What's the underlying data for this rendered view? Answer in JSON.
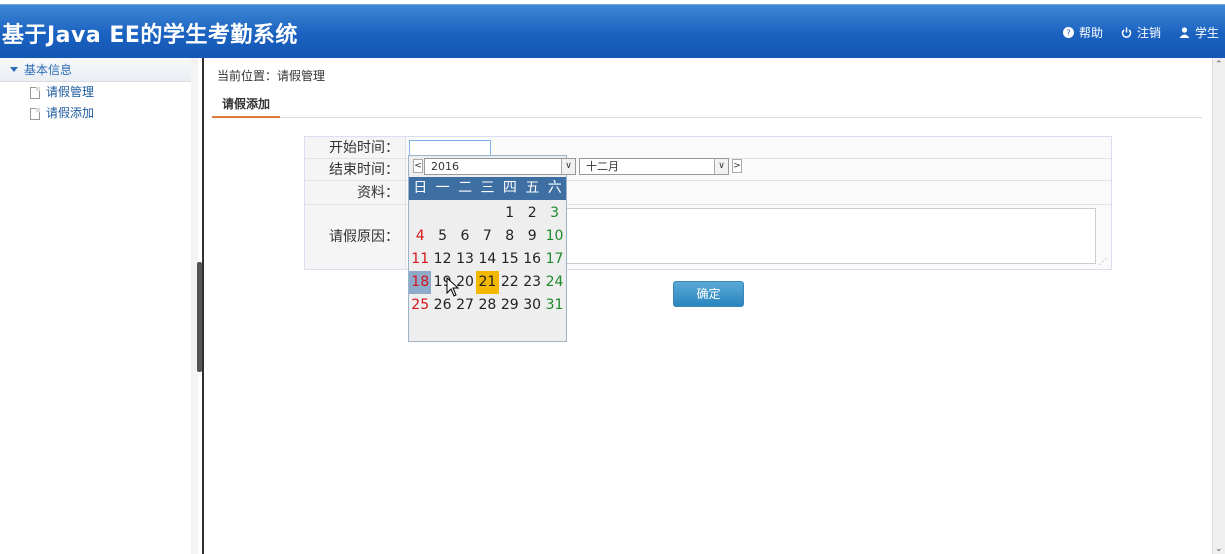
{
  "header": {
    "title": "基于Java EE的学生考勤系统",
    "nav": [
      {
        "icon": "help-icon",
        "label": "帮助"
      },
      {
        "icon": "power-icon",
        "label": "注销"
      },
      {
        "icon": "user-icon",
        "label": "学生"
      }
    ]
  },
  "sidebar": {
    "group_label": "基本信息",
    "items": [
      {
        "label": "请假管理"
      },
      {
        "label": "请假添加"
      }
    ]
  },
  "main": {
    "breadcrumb": "当前位置：请假管理",
    "tab_label": "请假添加",
    "form": {
      "start_label": "开始时间：",
      "end_label": "结束时间：",
      "material_label": "资料：",
      "reason_label": "请假原因："
    },
    "submit_label": "确定"
  },
  "datepicker": {
    "prev": "<",
    "next": ">",
    "year": "2016",
    "month": "十二月",
    "weekdays": [
      "日",
      "一",
      "二",
      "三",
      "四",
      "五",
      "六"
    ],
    "today": 18,
    "selected": 21,
    "first_weekday_index": 4,
    "days_in_month": 31
  },
  "colors": {
    "header_blue": "#1b62c0",
    "picker_head": "#3d6fa3",
    "sunday": "#d4161b",
    "saturday": "#1d8a2a",
    "selected": "#f3b800",
    "today": "#8eaacb",
    "button": "#2a85bf"
  }
}
